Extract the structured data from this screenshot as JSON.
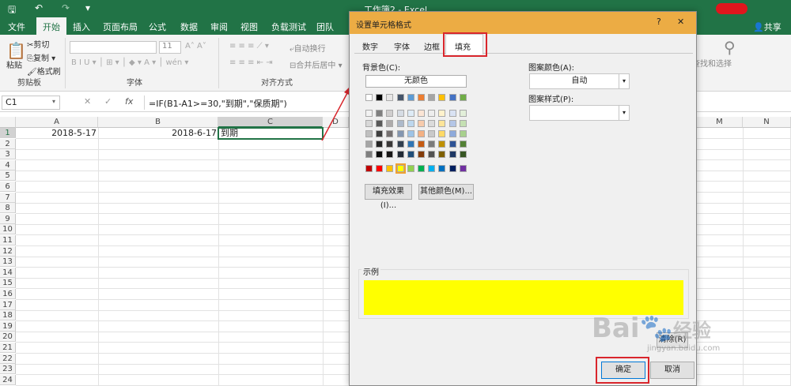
{
  "window": {
    "title": "工作簿2 - Excel",
    "share": "共享"
  },
  "ribbon": {
    "tabs": [
      "文件",
      "开始",
      "插入",
      "页面布局",
      "公式",
      "数据",
      "审阅",
      "视图",
      "负载测试",
      "团队"
    ],
    "clipboard": {
      "paste": "粘贴",
      "cut": "剪切",
      "copy": "复制",
      "format_painter": "格式刷",
      "group": "剪贴板"
    },
    "font": {
      "size": "11",
      "group": "字体"
    },
    "alignment": {
      "wrap": "自动换行",
      "merge": "合并后居中",
      "group": "对齐方式"
    },
    "editing": {
      "find": "查找和选择"
    }
  },
  "formula_bar": {
    "name_box": "C1",
    "formula": "=IF(B1-A1>=30,\"到期\",\"保质期\")"
  },
  "sheet": {
    "columns": [
      "A",
      "B",
      "C",
      "D",
      "M",
      "N"
    ],
    "rows": [
      "1",
      "2",
      "3",
      "4",
      "5",
      "6",
      "7",
      "8",
      "9",
      "10",
      "11",
      "12",
      "13",
      "14",
      "15",
      "16",
      "17",
      "18",
      "19",
      "20",
      "21",
      "22",
      "23",
      "24"
    ],
    "cells": {
      "A1": "2018-5-17",
      "B1": "2018-6-17",
      "C1": "到期"
    }
  },
  "dialog": {
    "title": "设置单元格格式",
    "help": "?",
    "close": "✕",
    "tabs": [
      "数字",
      "字体",
      "边框",
      "填充"
    ],
    "active_tab": "填充",
    "bg_label": "背景色(C):",
    "no_color": "无颜色",
    "pattern_color_label": "图案颜色(A):",
    "pattern_color_value": "自动",
    "pattern_style_label": "图案样式(P):",
    "fill_effects": "填充效果(I)...",
    "more_colors": "其他颜色(M)...",
    "sample_label": "示例",
    "sample_color": "#ffff00",
    "clear": "清除(R)",
    "ok": "确定",
    "cancel": "取消"
  },
  "palette": {
    "row1": [
      "#ffffff",
      "#000000",
      "#e7e6e6",
      "#44546a",
      "#5b9bd5",
      "#ed7d31",
      "#a5a5a5",
      "#ffc000",
      "#4472c4",
      "#70ad47"
    ],
    "tints": [
      [
        "#f2f2f2",
        "#7f7f7f",
        "#d0cece",
        "#d6dce4",
        "#deebf6",
        "#fbe5d5",
        "#ededed",
        "#fff2cc",
        "#d9e2f3",
        "#e2efd9"
      ],
      [
        "#d8d8d8",
        "#595959",
        "#aeabab",
        "#adb9ca",
        "#bdd7ee",
        "#f7cbac",
        "#dbdbdb",
        "#fee599",
        "#b4c6e7",
        "#c5e0b3"
      ],
      [
        "#bfbfbf",
        "#3f3f3f",
        "#757070",
        "#8496b0",
        "#9dc3e6",
        "#f4b183",
        "#c9c9c9",
        "#ffd965",
        "#8eaadb",
        "#a8d08d"
      ],
      [
        "#a5a5a5",
        "#262626",
        "#3a3838",
        "#323f4f",
        "#2e75b5",
        "#c55a11",
        "#7b7b7b",
        "#bf9000",
        "#2f5496",
        "#538135"
      ],
      [
        "#7f7f7f",
        "#0c0c0c",
        "#171616",
        "#222a35",
        "#1f4e79",
        "#833c0b",
        "#525252",
        "#7f6000",
        "#1f3864",
        "#375623"
      ]
    ],
    "standard": [
      "#c00000",
      "#ff0000",
      "#ffc000",
      "#ffff00",
      "#92d050",
      "#00b050",
      "#00b0f0",
      "#0070c0",
      "#002060",
      "#7030a0"
    ]
  },
  "watermark": {
    "brand": "Bai",
    "brand2": "经验",
    "url": "jingyan.baidu.com"
  }
}
